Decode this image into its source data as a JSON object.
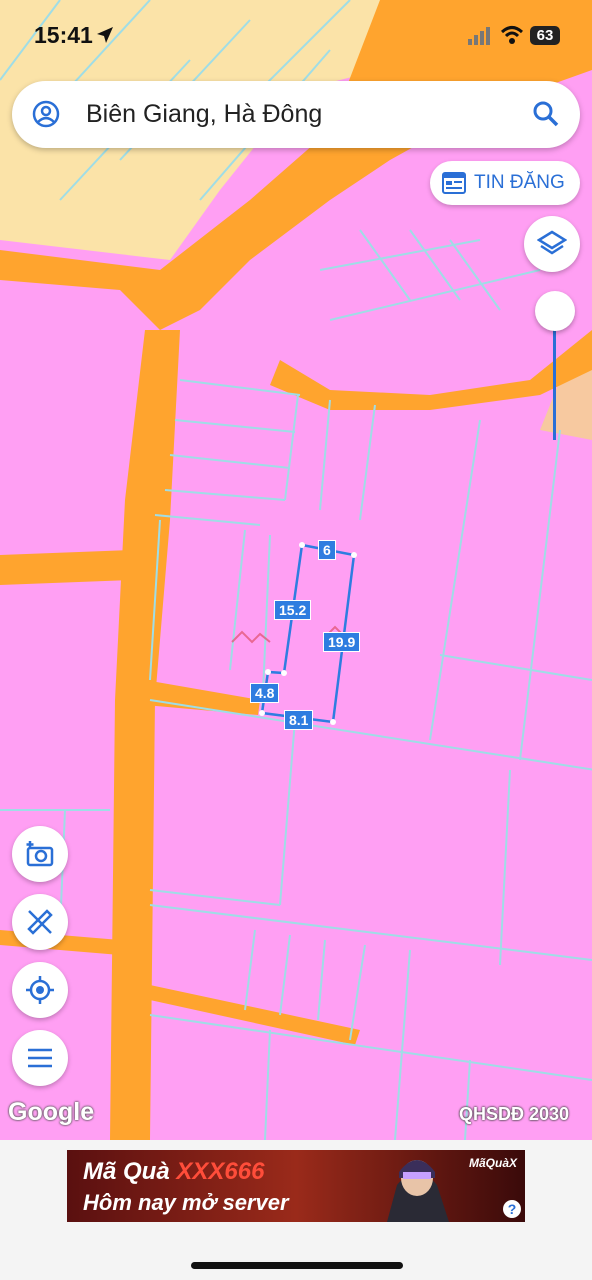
{
  "status": {
    "time": "15:41",
    "battery": "63"
  },
  "search": {
    "text": "Biên Giang, Hà Đông"
  },
  "buttons": {
    "tin_dang": "TIN ĐĂNG"
  },
  "dimensions": {
    "top": "6",
    "left": "15.2",
    "right": "19.9",
    "lower_left": "4.8",
    "bottom": "8.1"
  },
  "map": {
    "attribution": "Google",
    "layer": "QHSDĐ 2030"
  },
  "ad": {
    "line1_prefix": "Mã Quà ",
    "line1_code": "XXX666",
    "line2": "Hôm nay mở server",
    "brand": "MãQuàX",
    "help": "?"
  },
  "colors": {
    "residential": "#ff9ff3",
    "road": "#ffa42e",
    "other": "#fbe3a8",
    "accent": "#2a6fd6"
  }
}
